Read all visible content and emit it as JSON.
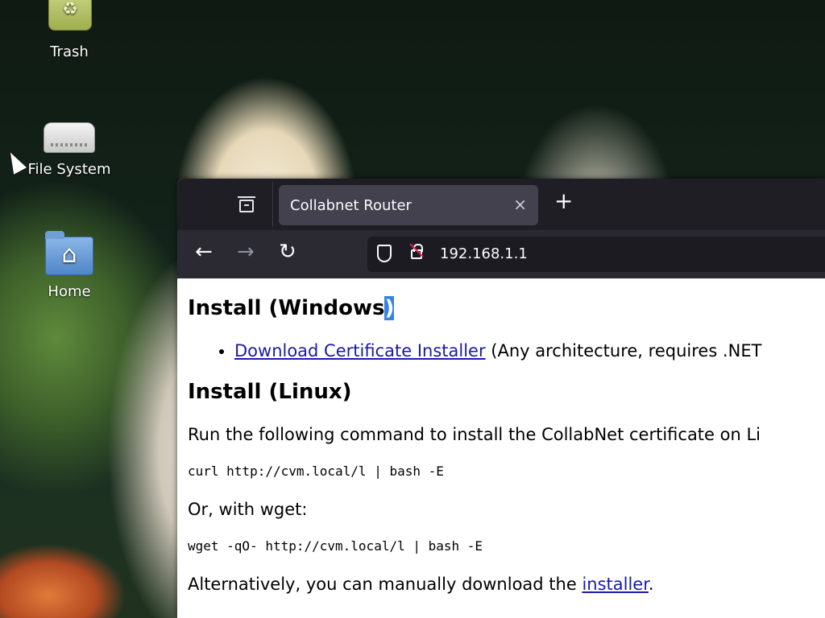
{
  "desktop": {
    "icons": [
      {
        "label": "Trash"
      },
      {
        "label": "File System"
      },
      {
        "label": "Home"
      }
    ]
  },
  "browser": {
    "tab": {
      "title": "Collabnet Router",
      "close": "×"
    },
    "new_tab": "+",
    "nav": {
      "back": "←",
      "forward": "→",
      "reload": "↻"
    },
    "url": "192.168.1.1"
  },
  "page": {
    "h_windows_main": "Install (Windows",
    "h_windows_sel": ")",
    "windows_link": "Download Certificate Installer",
    "windows_note": " (Any architecture, requires .NET",
    "h_linux": "Install (Linux)",
    "linux_intro": "Run the following command to install the CollabNet certificate on Li",
    "cmd_curl": "curl http://cvm.local/l | bash -E",
    "or_wget": "Or, with wget:",
    "cmd_wget": "wget -qO- http://cvm.local/l | bash -E",
    "alt_prefix": "Alternatively, you can manually download the ",
    "alt_link": "installer",
    "alt_suffix": "."
  },
  "colors": {
    "link": "#1a1aa6",
    "selection": "#3584e4",
    "tabbar": "#1f1e25",
    "navbar": "#2b2a33"
  }
}
